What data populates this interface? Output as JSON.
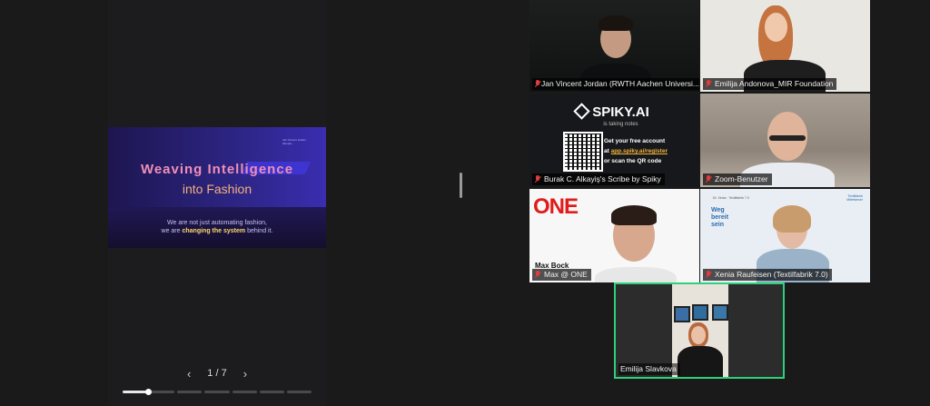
{
  "presentation": {
    "slide": {
      "title_line1": "Weaving Intelligence",
      "title_line2": "into Fashion",
      "subtitle_line1": "We are not just automating fashion,",
      "subtitle_pre": "we are ",
      "subtitle_highlight": "changing the system",
      "subtitle_post": " behind it.",
      "logo_text": "Jan Vincent Jordan · Mendel..."
    },
    "pager": {
      "label": "1 / 7",
      "prev": "‹",
      "next": "›",
      "current_page": 1,
      "total_pages": 7
    }
  },
  "participants": [
    {
      "name": "Jan Vincent Jordan (RWTH Aachen Universi...",
      "muted": true
    },
    {
      "name": "Emilija Andonova_MIR Foundation",
      "muted": true
    },
    {
      "name": "Burak C. Alkayiş's Scribe by Spiky",
      "muted": true
    },
    {
      "name": "Zoom-Benutzer",
      "muted": true
    },
    {
      "name": "Max @ ONE",
      "muted": true
    },
    {
      "name": "Xenia Raufeisen (Textilfabrik 7.0)",
      "muted": true
    },
    {
      "name": "Emilija Slavkova",
      "muted": false,
      "speaking": true
    }
  ],
  "spiky": {
    "brand": "SPIKY.AI",
    "status": "is taking notes",
    "cta_line1": "Get your free account",
    "cta_pre": "at ",
    "cta_url": "app.spiky.ai/register",
    "cta_line3": "or scan the QR code"
  },
  "one_tile": {
    "logo": "ONE",
    "caption": "Max Bock"
  },
  "textilfabrik_tile": {
    "headline_1": "Weg",
    "headline_2": "bereit",
    "headline_3": "sein",
    "top_text": "Dr. Xenia · Textilfabrik 7.0",
    "logo": "Textilfabrik Mittelweser"
  },
  "colors": {
    "speaking_border": "#2fd07b",
    "muted_icon": "#e23b3b",
    "slide_pink": "#f08fb8",
    "slide_orange": "#f4b07a",
    "slide_highlight": "#ffd86b",
    "spiky_link": "#f2b33d"
  }
}
